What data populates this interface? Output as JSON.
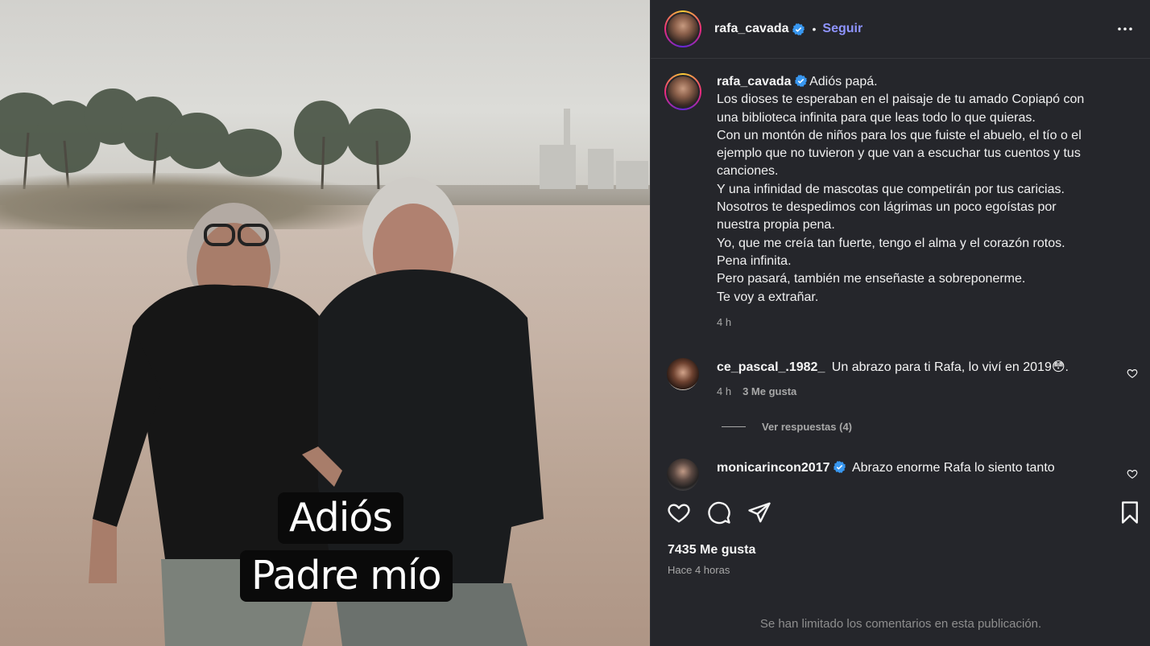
{
  "post": {
    "story_text": [
      "Adiós",
      "Padre mío"
    ]
  },
  "header": {
    "username": "rafa_cavada",
    "separator": "•",
    "follow_label": "Seguir"
  },
  "caption": {
    "username": "rafa_cavada",
    "lines": [
      "Adiós papá.",
      "Los dioses te esperaban en el paisaje de tu amado Copiapó con",
      "una biblioteca infinita para que leas todo lo que quieras.",
      "Con un montón de niños para los que fuiste el abuelo, el tío o el",
      "ejemplo que no tuvieron y que van a escuchar tus cuentos y tus",
      "canciones.",
      "Y una infinidad de mascotas que competirán por tus caricias.",
      "Nosotros te despedimos con lágrimas un poco egoístas por",
      "nuestra propia pena.",
      "Yo, que me creía tan fuerte, tengo el alma y el corazón rotos.",
      "Pena infinita.",
      "Pero pasará, también me enseñaste a sobreponerme.",
      "Te voy a extrañar."
    ],
    "time": "4 h"
  },
  "comments": [
    {
      "username": "ce_pascal_.1982_",
      "text": "Un abrazo para ti Rafa, lo viví en 2019😳.",
      "time": "4 h",
      "likes": "3 Me gusta"
    },
    {
      "username": "monicarincon2017",
      "text": "Abrazo enorme Rafa lo siento tanto"
    }
  ],
  "replies_label": "Ver respuestas (4)",
  "likes_label": "7435 Me gusta",
  "posted_ago": "Hace 4 horas",
  "limited_notice": "Se han limitado los comentarios en esta publicación.",
  "colors": {
    "panel_bg": "#25262b",
    "link": "#8f94ff",
    "verified": "#3897f0",
    "muted": "#a8a8a8"
  }
}
